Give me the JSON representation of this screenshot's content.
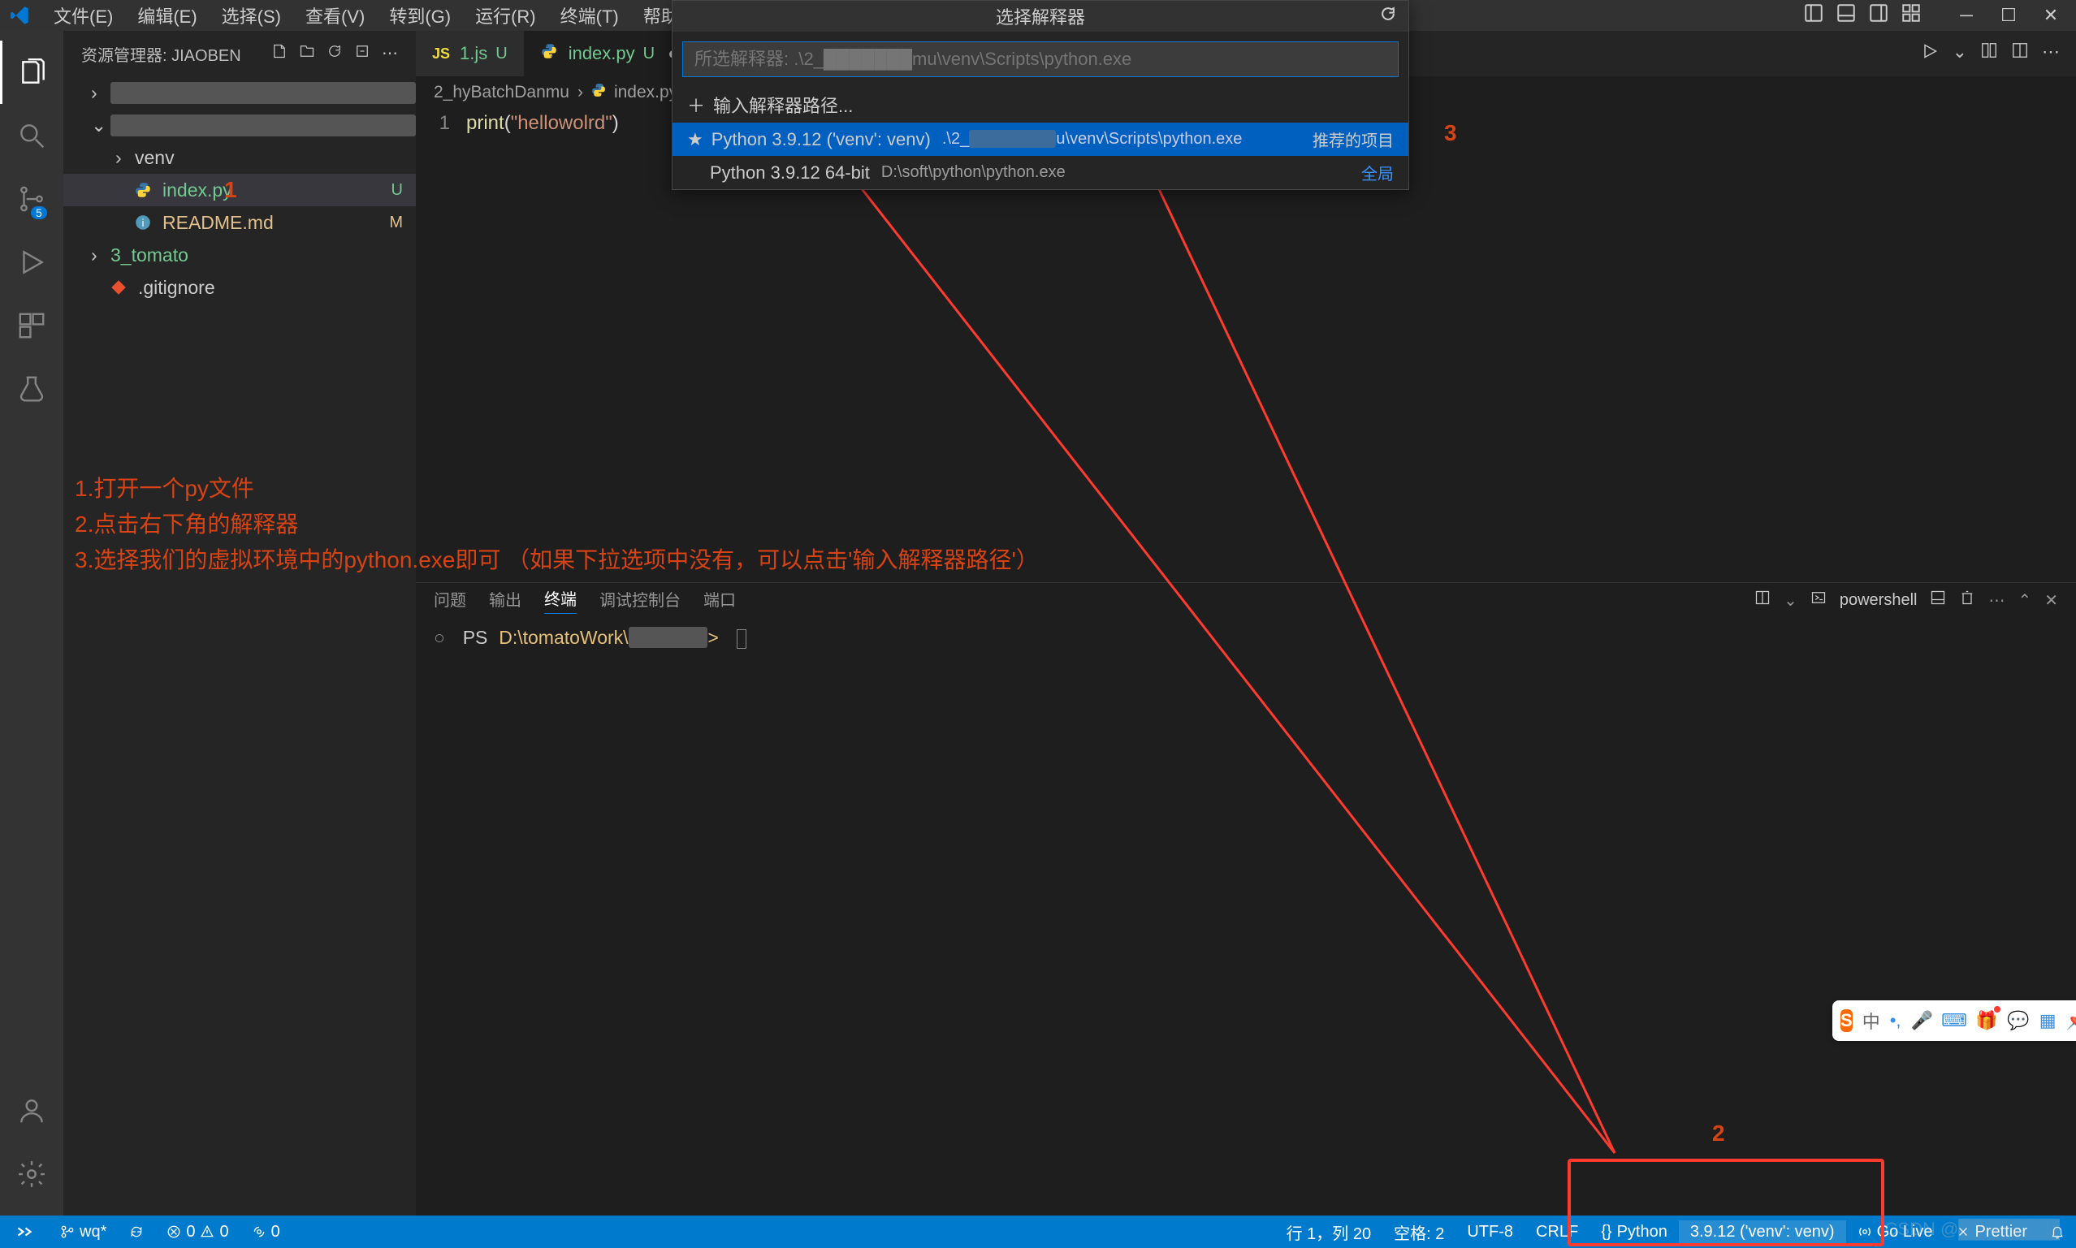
{
  "titlebar": {
    "menu": [
      "文件(E)",
      "编辑(E)",
      "选择(S)",
      "查看(V)",
      "转到(G)",
      "运行(R)",
      "终端(T)",
      "帮助(H)"
    ]
  },
  "sidebar": {
    "title": "资源管理器: JIAOBEN",
    "items": [
      {
        "chevron": "›",
        "label": "█████",
        "indent": 1,
        "redacted": true
      },
      {
        "chevron": "⌄",
        "label": "████████",
        "indent": 1,
        "redacted": true
      },
      {
        "chevron": "›",
        "label": "venv",
        "indent": 2
      },
      {
        "icon": "py",
        "label": "index.py",
        "indent": 2,
        "badge": "U",
        "git": "u",
        "selected": true
      },
      {
        "icon": "info",
        "label": "README.md",
        "indent": 2,
        "badge": "M",
        "git": "m"
      },
      {
        "chevron": "›",
        "label": "3_tomato",
        "indent": 1,
        "git": "u"
      },
      {
        "icon": "git",
        "label": ".gitignore",
        "indent": 1
      }
    ]
  },
  "tabs": [
    {
      "icon": "js",
      "label": "1.js",
      "badge": "U",
      "git": "u"
    },
    {
      "icon": "py",
      "label": "index.py",
      "badge": "U",
      "git": "u",
      "active": true,
      "dirty": true
    }
  ],
  "breadcrumb": [
    "2_hyBatchDanmu",
    "index.py"
  ],
  "editor": {
    "line_no": "1",
    "code_fn": "print",
    "code_str": "\"hellowolrd\""
  },
  "picker": {
    "title": "选择解释器",
    "placeholder": "所选解释器: .\\2_███████mu\\venv\\Scripts\\python.exe",
    "enter_path": "输入解释器路径...",
    "items": [
      {
        "star": true,
        "label": "Python 3.9.12 ('venv': venv)",
        "path_pre": ".\\2_",
        "path_redact": "███████",
        "path_post": "u\\venv\\Scripts\\python.exe",
        "right": "推荐的项目",
        "highlighted": true
      },
      {
        "label": "Python 3.9.12 64-bit",
        "path": "D:\\soft\\python\\python.exe",
        "right": "全局",
        "right_color": "#3794ff"
      }
    ]
  },
  "annotations": {
    "num1": "1",
    "num2": "2",
    "num3": "3",
    "lines": [
      "1.打开一个py文件",
      "2.点击右下角的解释器",
      "3.选择我们的虚拟环境中的python.exe即可  （如果下拉选项中没有，可以点击'输入解释器路径'）"
    ]
  },
  "terminal": {
    "tabs": [
      "问题",
      "输出",
      "终端",
      "调试控制台",
      "端口"
    ],
    "active_tab": 2,
    "shell_label": "powershell",
    "prompt_prefix": "PS",
    "prompt_path": "D:\\tomatoWork\\",
    "prompt_redact": "██████"
  },
  "statusbar": {
    "left": [
      {
        "icon": "remote",
        "label": ""
      },
      {
        "icon": "branch",
        "label": "wq*"
      },
      {
        "icon": "sync",
        "label": ""
      },
      {
        "icon": "error",
        "label": "0"
      },
      {
        "icon": "warning",
        "label": "0"
      },
      {
        "icon": "port",
        "label": "0"
      }
    ],
    "right": [
      {
        "label": "行 1，列 20"
      },
      {
        "label": "空格: 2"
      },
      {
        "label": "UTF-8"
      },
      {
        "label": "CRLF"
      },
      {
        "icon": "py",
        "label": "Python"
      },
      {
        "label": "3.9.12 ('venv': venv)",
        "highlight": true
      },
      {
        "icon": "live",
        "label": "Go Live"
      },
      {
        "icon": "prettier",
        "label": "Prettier"
      },
      {
        "icon": "bell",
        "label": ""
      }
    ]
  },
  "ime": {
    "logo": "S",
    "lang": "中"
  },
  "watermark": "CSDN @████████"
}
